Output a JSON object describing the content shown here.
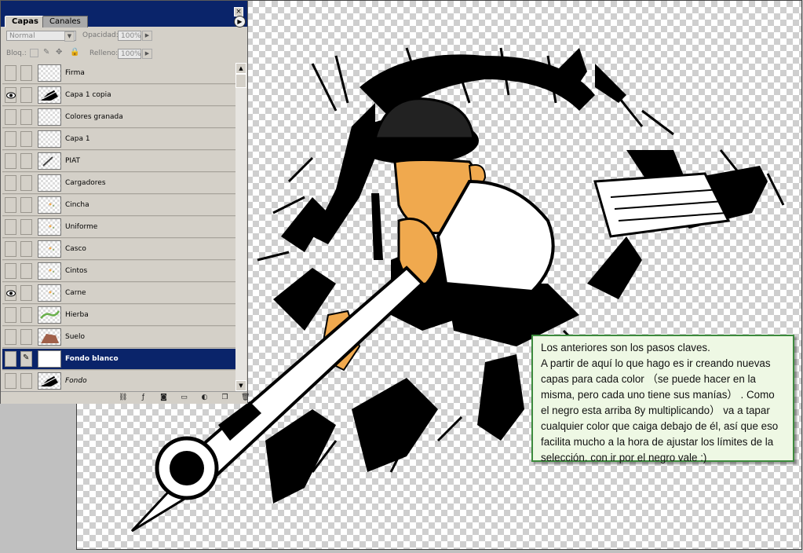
{
  "palette": {
    "tabs": [
      "Capas",
      "Canales"
    ],
    "blend_mode": "Normal",
    "opacity_label": "Opacidad:",
    "opacity_value": "100%",
    "lock_label": "Bloq.:",
    "fill_label": "Relleno:",
    "fill_value": "100%",
    "close_glyph": "×",
    "menu_glyph": "▶"
  },
  "layers": [
    {
      "name": "Firma",
      "visible": false,
      "selected": false,
      "thumb": "empty"
    },
    {
      "name": "Capa 1 copia",
      "visible": true,
      "selected": false,
      "thumb": "drawing"
    },
    {
      "name": "Colores granada",
      "visible": false,
      "selected": false,
      "thumb": "empty"
    },
    {
      "name": "Capa 1",
      "visible": false,
      "selected": false,
      "thumb": "empty"
    },
    {
      "name": "PIAT",
      "visible": false,
      "selected": false,
      "thumb": "stroke"
    },
    {
      "name": "Cargadores",
      "visible": false,
      "selected": false,
      "thumb": "empty"
    },
    {
      "name": "Cincha",
      "visible": false,
      "selected": false,
      "thumb": "dots"
    },
    {
      "name": "Uniforme",
      "visible": false,
      "selected": false,
      "thumb": "dots"
    },
    {
      "name": "Casco",
      "visible": false,
      "selected": false,
      "thumb": "dots"
    },
    {
      "name": "Cintos",
      "visible": false,
      "selected": false,
      "thumb": "dots"
    },
    {
      "name": "Carne",
      "visible": true,
      "selected": false,
      "thumb": "dots"
    },
    {
      "name": "Hierba",
      "visible": false,
      "selected": false,
      "thumb": "green"
    },
    {
      "name": "Suelo",
      "visible": false,
      "selected": false,
      "thumb": "brown"
    },
    {
      "name": "Fondo blanco",
      "visible": false,
      "selected": true,
      "thumb": "white"
    },
    {
      "name": "Fondo",
      "visible": false,
      "selected": false,
      "thumb": "drawing",
      "italic": true
    }
  ],
  "note": {
    "text": "Los anteriores son los pasos claves.\nA partir de aquí lo que hago es ir creando nuevas capas para cada color （se puede hacer en la misma, pero cada uno tiene sus manías） . Como el negro esta arriba 8y multiplicando） va a tapar cualquier color que caiga debajo de él, así que eso facilita mucho a la hora de ajustar los límites de la selección. con ir por el negro vale :)"
  },
  "colors": {
    "skin": "#f0a94e",
    "selection": "#0a246a",
    "note_bg": "#eef8e4",
    "note_border": "#3c8a3c"
  },
  "bottom_icons": [
    "link-icon",
    "layer-style-icon",
    "mask-icon",
    "new-set-icon",
    "adjustment-icon",
    "new-layer-icon",
    "trash-icon"
  ]
}
